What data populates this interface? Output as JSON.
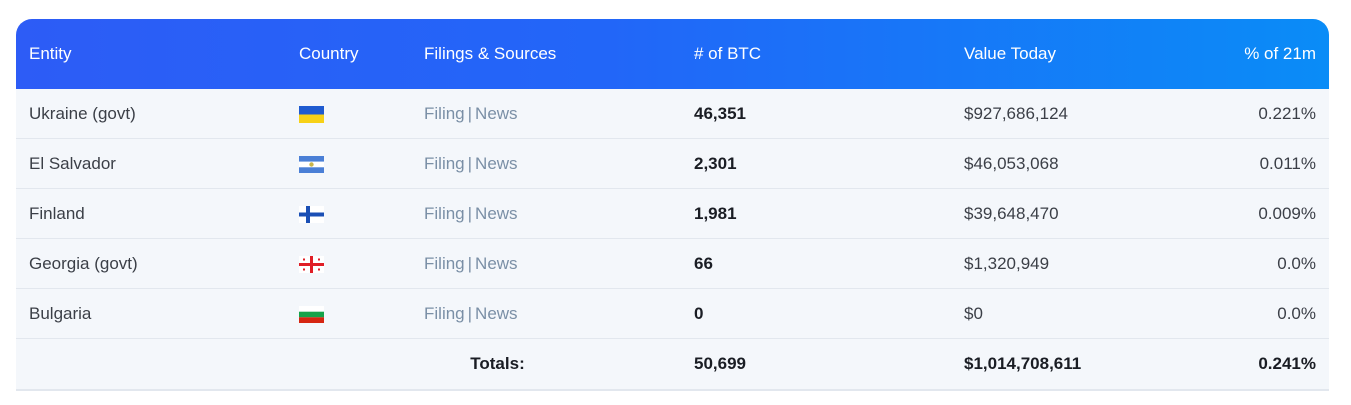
{
  "header": {
    "entity": "Entity",
    "country": "Country",
    "filings": "Filings & Sources",
    "btc": "# of BTC",
    "value": "Value Today",
    "pct": "% of 21m"
  },
  "rows": [
    {
      "entity": "Ukraine (govt)",
      "flag": "ukraine-flag-icon",
      "filing": "Filing",
      "sep": "|",
      "news": "News",
      "btc": "46,351",
      "value": "$927,686,124",
      "pct": "0.221%"
    },
    {
      "entity": "El Salvador",
      "flag": "el-salvador-flag-icon",
      "filing": "Filing",
      "sep": "|",
      "news": "News",
      "btc": "2,301",
      "value": "$46,053,068",
      "pct": "0.011%"
    },
    {
      "entity": "Finland",
      "flag": "finland-flag-icon",
      "filing": "Filing",
      "sep": "|",
      "news": "News",
      "btc": "1,981",
      "value": "$39,648,470",
      "pct": "0.009%"
    },
    {
      "entity": "Georgia (govt)",
      "flag": "georgia-flag-icon",
      "filing": "Filing",
      "sep": "|",
      "news": "News",
      "btc": "66",
      "value": "$1,320,949",
      "pct": "0.0%"
    },
    {
      "entity": "Bulgaria",
      "flag": "bulgaria-flag-icon",
      "filing": "Filing",
      "sep": "|",
      "news": "News",
      "btc": "0",
      "value": "$0",
      "pct": "0.0%"
    }
  ],
  "totals": {
    "label": "Totals:",
    "btc": "50,699",
    "value": "$1,014,708,611",
    "pct": "0.241%"
  },
  "colors": {
    "header_start": "#2d5cf6",
    "header_end": "#0a8cf7",
    "row_bg": "#f4f7fb",
    "link": "#7a8fa6"
  }
}
